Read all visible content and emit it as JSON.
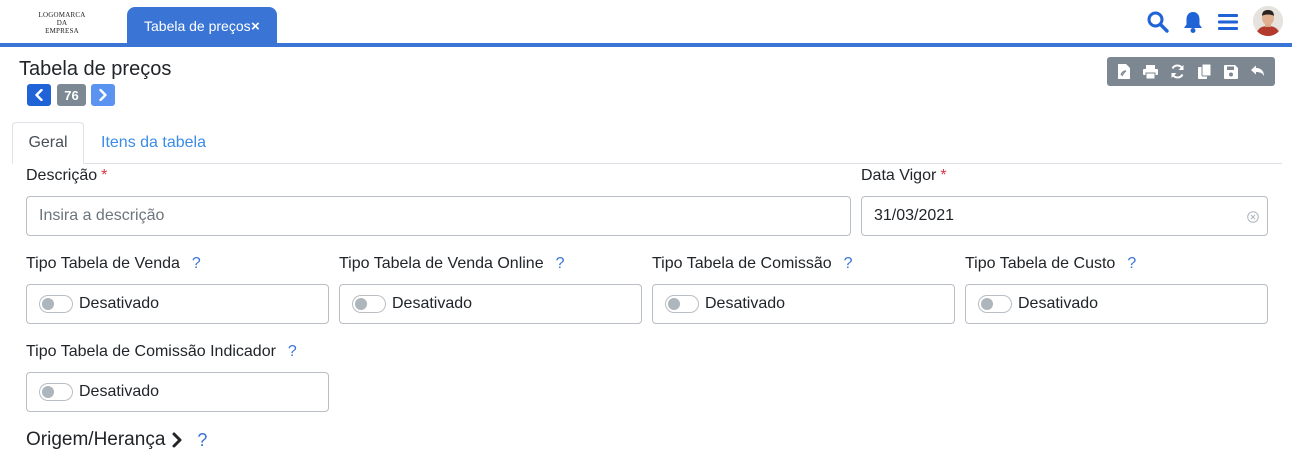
{
  "header": {
    "logo_lines": [
      "LOGOMARCA",
      "DA",
      "EMPRESA"
    ],
    "open_tab": {
      "label": "Tabela de preços",
      "close": "×"
    },
    "icons": [
      "search-icon",
      "bell-icon",
      "menu-icon",
      "avatar"
    ]
  },
  "page": {
    "title": "Tabela de preços",
    "record_number": "76",
    "toolbar_icons": [
      "pdf-icon",
      "print-icon",
      "refresh-icon",
      "copy-icon",
      "save-icon",
      "undo-icon"
    ]
  },
  "tabs": [
    {
      "label": "Geral",
      "active": true
    },
    {
      "label": "Itens da tabela",
      "active": false
    }
  ],
  "form": {
    "descricao": {
      "label": "Descrição",
      "required": "*",
      "placeholder": "Insira a descrição",
      "value": ""
    },
    "data_vigor": {
      "label": "Data Vigor",
      "required": "*",
      "value": "31/03/2021"
    },
    "help_mark": "?",
    "toggles": [
      {
        "label": "Tipo Tabela de Venda",
        "state": "Desativado"
      },
      {
        "label": "Tipo Tabela de Venda Online",
        "state": "Desativado"
      },
      {
        "label": "Tipo Tabela de Comissão",
        "state": "Desativado"
      },
      {
        "label": "Tipo Tabela de Custo",
        "state": "Desativado"
      },
      {
        "label": "Tipo Tabela de Comissão Indicador",
        "state": "Desativado"
      }
    ],
    "section": {
      "label": "Origem/Herança"
    }
  },
  "colors": {
    "primary": "#3a75d6",
    "required": "#dc3545",
    "toolbar": "#7d8791"
  }
}
